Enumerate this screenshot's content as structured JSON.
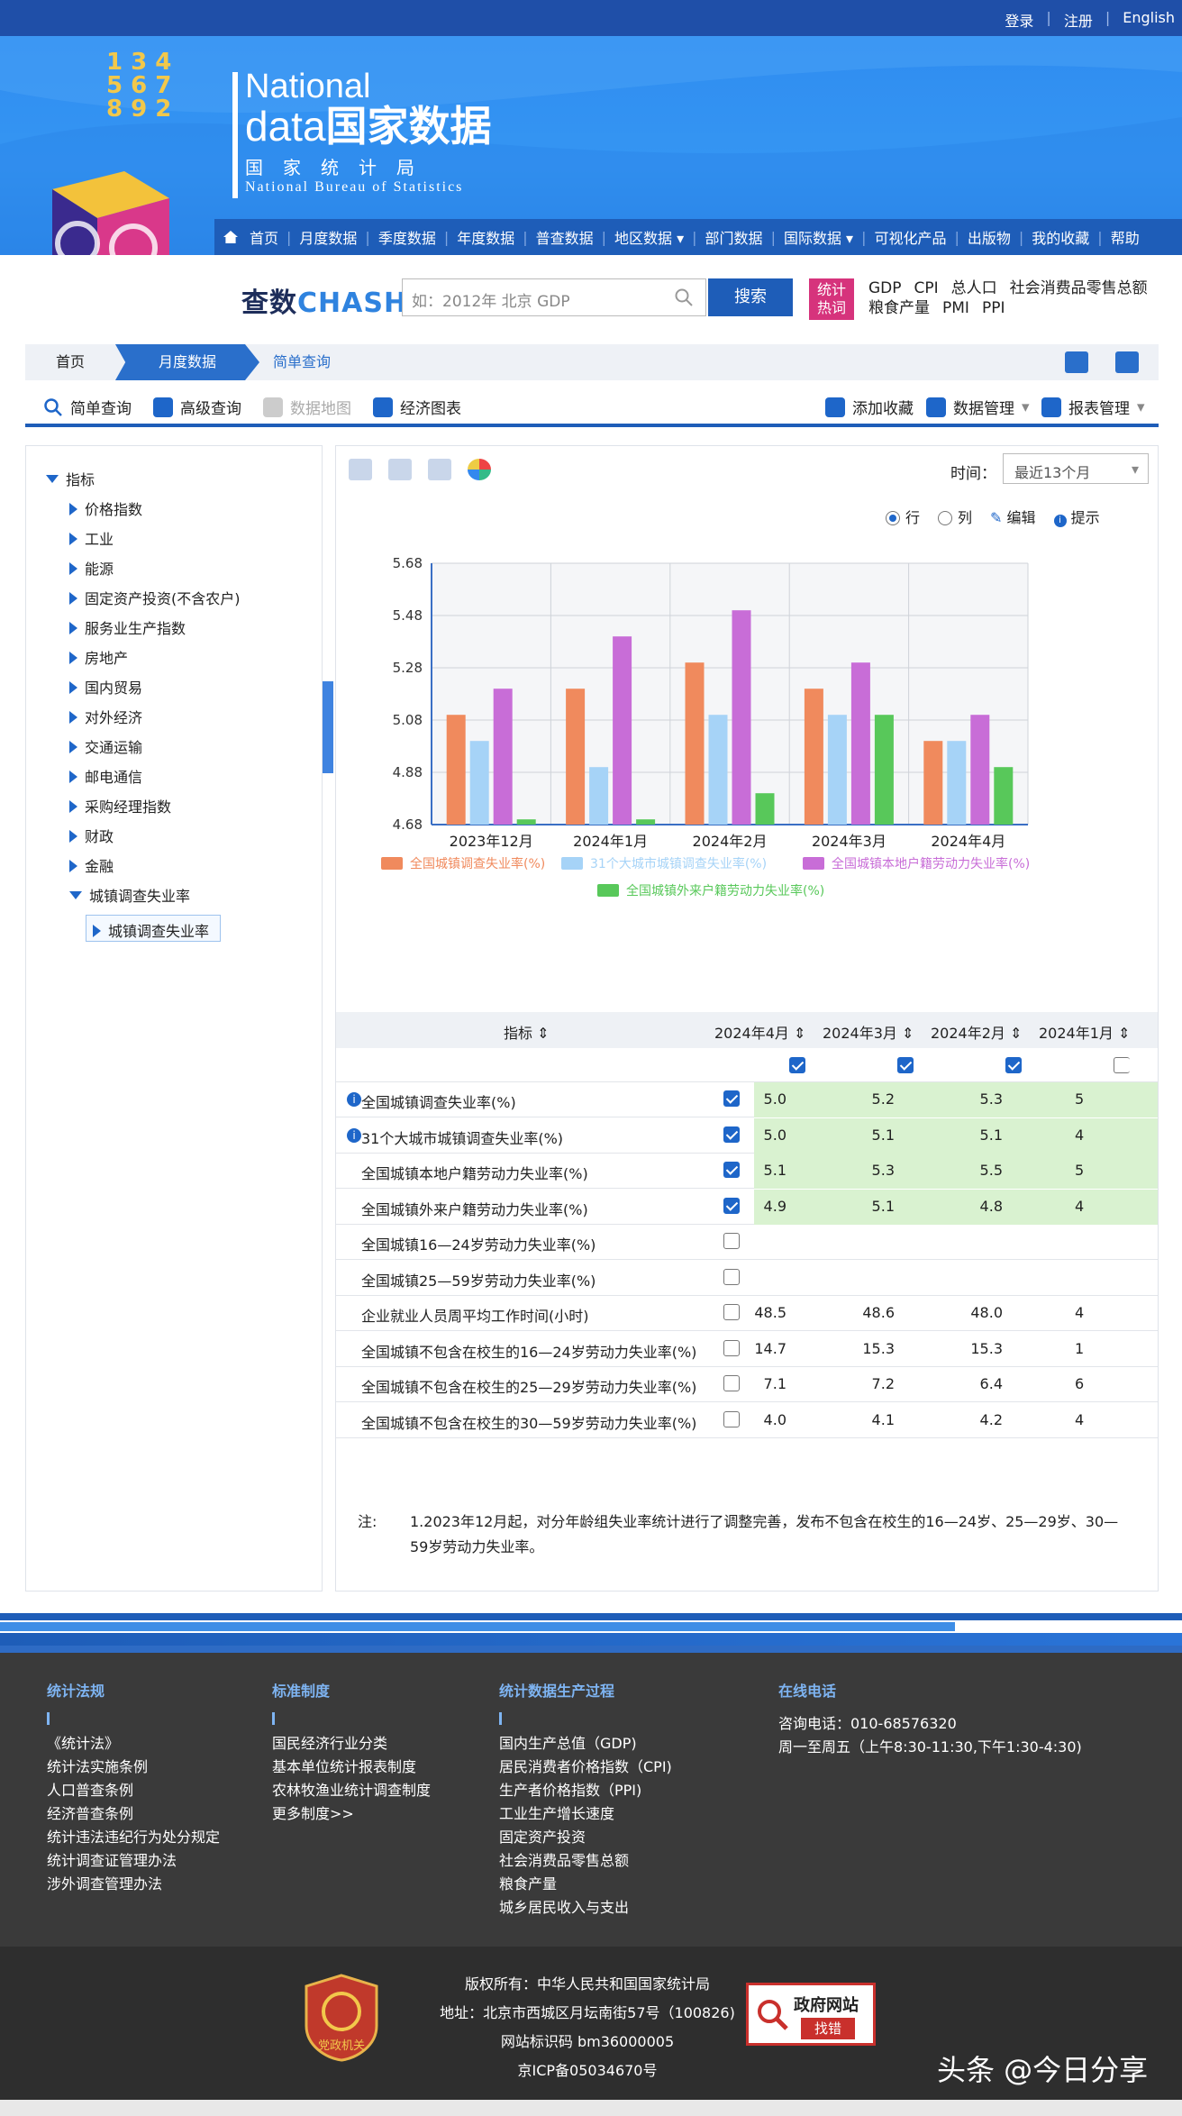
{
  "topbar": {
    "login": "登录",
    "register": "注册",
    "english": "English"
  },
  "header": {
    "title_en_1": "National",
    "title_en_2a": "data",
    "title_en_2b": "国家数据",
    "title_cn": "国家统计局",
    "title_bureau": "National Bureau of Statistics",
    "logo_digits": "1 3 4 5 6 7 8 9 2"
  },
  "nav": [
    "首页",
    "月度数据",
    "季度数据",
    "年度数据",
    "普查数据",
    "地区数据 ▾",
    "部门数据",
    "国际数据 ▾",
    "可视化产品",
    "出版物",
    "我的收藏",
    "帮助"
  ],
  "search": {
    "brand_a": "查数",
    "brand_b": "CHASHU",
    "placeholder": "如：2012年 北京 GDP",
    "button": "搜索",
    "hot_badge_1": "统计",
    "hot_badge_2": "热词",
    "hot_line_1": [
      "GDP",
      "CPI",
      "总人口",
      "社会消费品零售总额"
    ],
    "hot_line_2": [
      "粮食产量",
      "PMI",
      "PPI"
    ]
  },
  "breadcrumb": {
    "home": "首页",
    "monthly": "月度数据",
    "current": "简单查询"
  },
  "toolbar": {
    "simple": "简单查询",
    "advanced": "高级查询",
    "map": "数据地图",
    "charts": "经济图表",
    "add_fav": "添加收藏",
    "data_mgmt": "数据管理",
    "report_mgmt": "报表管理"
  },
  "tree": {
    "root": "指标",
    "items": [
      "价格指数",
      "工业",
      "能源",
      "固定资产投资(不含农户)",
      "服务业生产指数",
      "房地产",
      "国内贸易",
      "对外经济",
      "交通运输",
      "邮电通信",
      "采购经理指数",
      "财政",
      "金融",
      "城镇调查失业率"
    ],
    "selected": "城镇调查失业率"
  },
  "panel": {
    "time_label": "时间：",
    "time_value": "最近13个月",
    "opt_row": "行",
    "opt_col": "列",
    "opt_edit": "编辑",
    "opt_tip": "提示"
  },
  "chart_data": {
    "type": "bar",
    "categories": [
      "2023年12月",
      "2024年1月",
      "2024年2月",
      "2024年3月",
      "2024年4月"
    ],
    "ylim": [
      4.68,
      5.68
    ],
    "yticks": [
      "5.68",
      "5.48",
      "5.28",
      "5.08",
      "4.88",
      "4.68"
    ],
    "grid": true,
    "legend_position": "bottom",
    "series": [
      {
        "name": "全国城镇调查失业率(%)",
        "color": "#f08a5d",
        "values": [
          5.1,
          5.2,
          5.3,
          5.2,
          5.0
        ]
      },
      {
        "name": "31个大城市城镇调查失业率(%)",
        "color": "#a6d3f7",
        "values": [
          5.0,
          4.9,
          5.1,
          5.1,
          5.0
        ]
      },
      {
        "name": "全国城镇本地户籍劳动力失业率(%)",
        "color": "#c86dd7",
        "values": [
          5.2,
          5.4,
          5.5,
          5.3,
          5.1
        ]
      },
      {
        "name": "全国城镇外来户籍劳动力失业率(%)",
        "color": "#58c85a",
        "values": [
          4.7,
          4.7,
          4.8,
          5.1,
          4.9
        ]
      }
    ]
  },
  "table": {
    "header": {
      "indicator": "指标",
      "cols": [
        "2024年4月",
        "2024年3月",
        "2024年2月",
        "2024年1月"
      ]
    },
    "rows": [
      {
        "name": "全国城镇调查失业率(%)",
        "checked": true,
        "info": true,
        "values": [
          "5.0",
          "5.2",
          "5.3",
          "5"
        ]
      },
      {
        "name": "31个大城市城镇调查失业率(%)",
        "checked": true,
        "info": true,
        "values": [
          "5.0",
          "5.1",
          "5.1",
          "4"
        ]
      },
      {
        "name": "全国城镇本地户籍劳动力失业率(%)",
        "checked": true,
        "info": false,
        "values": [
          "5.1",
          "5.3",
          "5.5",
          "5"
        ]
      },
      {
        "name": "全国城镇外来户籍劳动力失业率(%)",
        "checked": true,
        "info": false,
        "values": [
          "4.9",
          "5.1",
          "4.8",
          "4"
        ]
      },
      {
        "name": "全国城镇16—24岁劳动力失业率(%)",
        "checked": false,
        "info": false,
        "values": [
          "",
          "",
          "",
          ""
        ]
      },
      {
        "name": "全国城镇25—59岁劳动力失业率(%)",
        "checked": false,
        "info": false,
        "values": [
          "",
          "",
          "",
          ""
        ]
      },
      {
        "name": "企业就业人员周平均工作时间(小时)",
        "checked": false,
        "info": false,
        "values": [
          "48.5",
          "48.6",
          "48.0",
          "4"
        ]
      },
      {
        "name": "全国城镇不包含在校生的16—24岁劳动力失业率(%)",
        "checked": false,
        "info": false,
        "values": [
          "14.7",
          "15.3",
          "15.3",
          "1"
        ]
      },
      {
        "name": "全国城镇不包含在校生的25—29岁劳动力失业率(%)",
        "checked": false,
        "info": false,
        "values": [
          "7.1",
          "7.2",
          "6.4",
          "6"
        ]
      },
      {
        "name": "全国城镇不包含在校生的30—59岁劳动力失业率(%)",
        "checked": false,
        "info": false,
        "values": [
          "4.0",
          "4.1",
          "4.2",
          "4"
        ]
      }
    ],
    "note_label": "注:",
    "note_text": "1.2023年12月起，对分年龄组失业率统计进行了调整完善，发布不包含在校生的16—24岁、25—29岁、30—59岁劳动力失业率。"
  },
  "footer": {
    "col1": {
      "title": "统计法规",
      "items": [
        "《统计法》",
        "统计法实施条例",
        "人口普查条例",
        "经济普查条例",
        "统计违法违纪行为处分规定",
        "统计调查证管理办法",
        "涉外调查管理办法"
      ]
    },
    "col2": {
      "title": "标准制度",
      "items": [
        "国民经济行业分类",
        "基本单位统计报表制度",
        "农林牧渔业统计调查制度",
        "更多制度>>"
      ]
    },
    "col3": {
      "title": "统计数据生产过程",
      "items": [
        "国内生产总值（GDP)",
        "居民消费者价格指数（CPI)",
        "生产者价格指数（PPI)",
        "工业生产增长速度",
        "固定资产投资",
        "社会消费品零售总额",
        "粮食产量",
        "城乡居民收入与支出"
      ]
    },
    "col4": {
      "title": "在线电话",
      "items": [
        "咨询电话：010-68576320",
        "周一至周五（上午8:30-11:30,下午1:30-4:30)"
      ]
    }
  },
  "copyright": {
    "lines": [
      "版权所有：中华人民共和国国家统计局",
      "地址：北京市西城区月坛南街57号（100826)",
      "网站标识码 bm36000005",
      "京ICP备05034670号"
    ],
    "emblem_text": "党政机关",
    "gov_badge_1": "政府网站",
    "gov_badge_2": "找错"
  },
  "watermark": "头条 @今日分享"
}
